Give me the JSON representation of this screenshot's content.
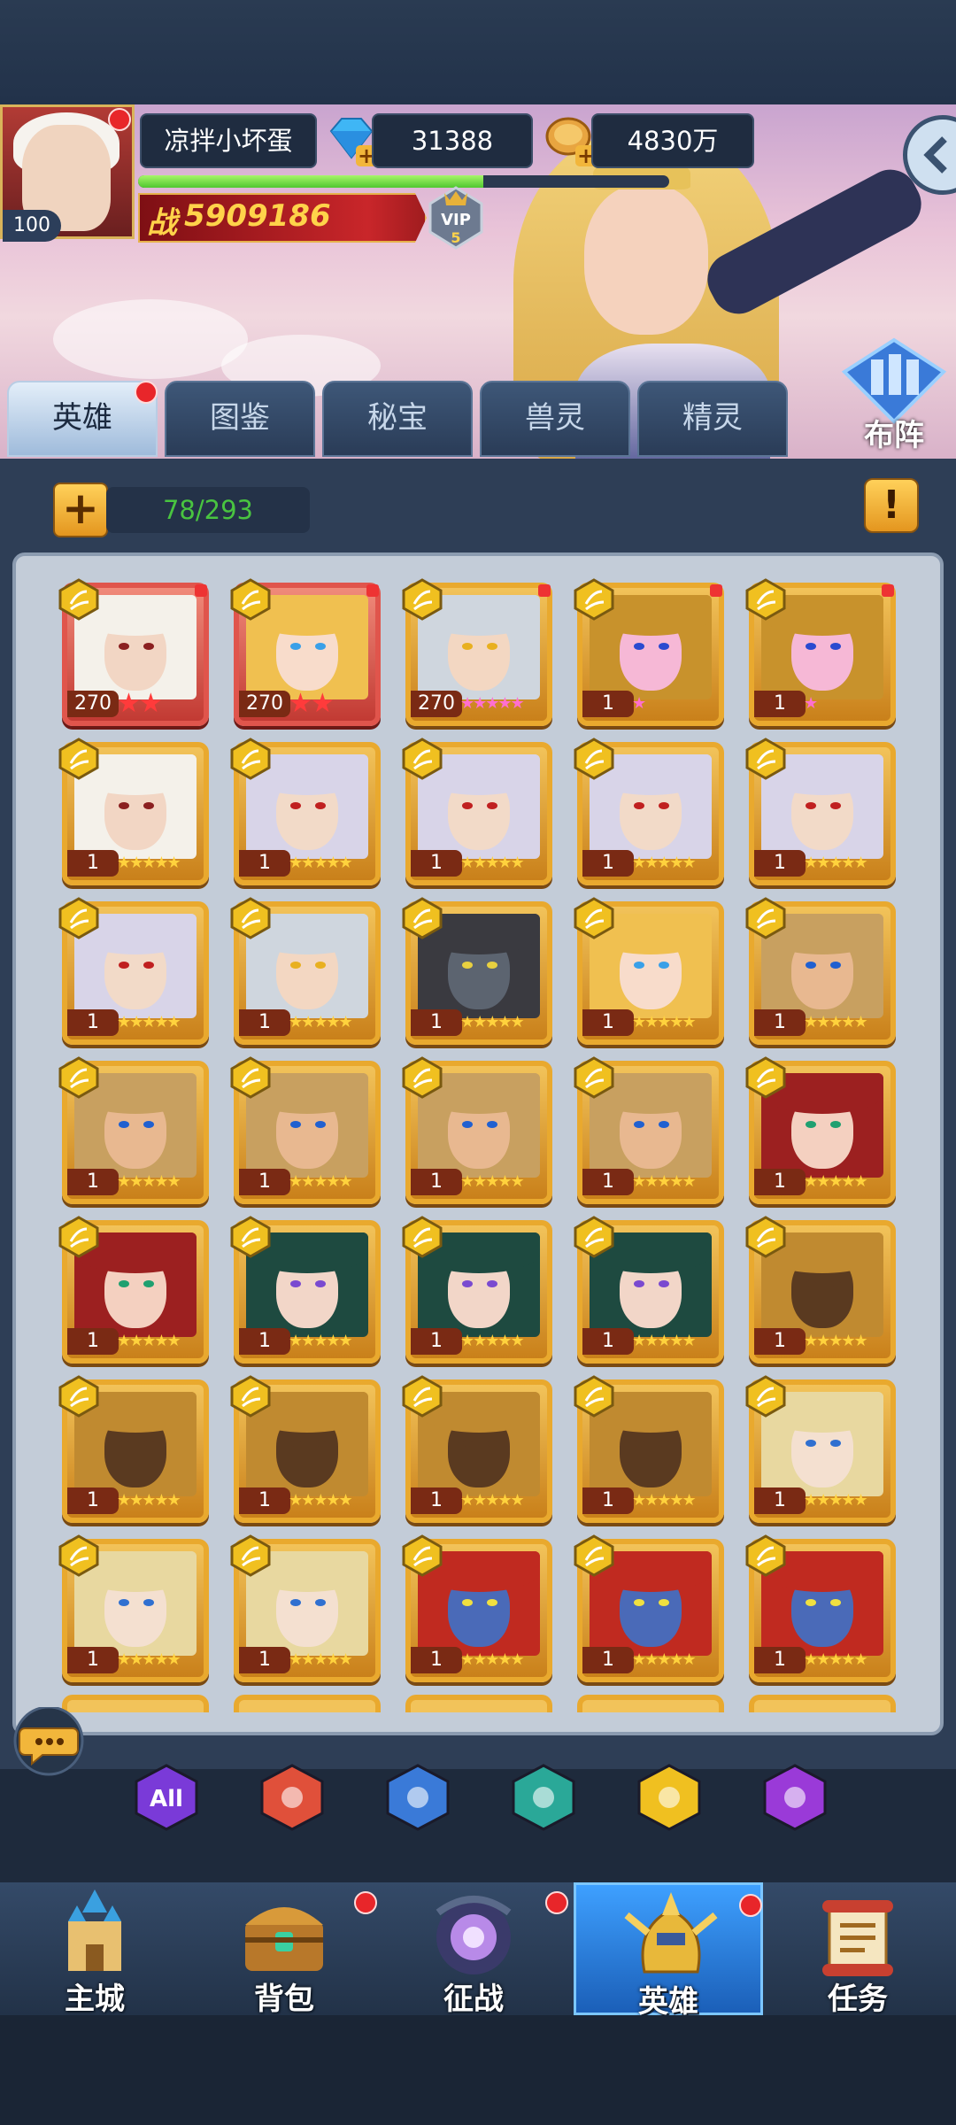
{
  "player": {
    "name": "凉拌小坏蛋",
    "level": "100",
    "power_label": "战",
    "power": "5909186",
    "vip": "VIP",
    "vip_level": "5",
    "exp_progress": 0.65
  },
  "resources": {
    "diamonds": "31388",
    "gold": "4830万"
  },
  "formation": {
    "label": "布阵"
  },
  "tabs": [
    {
      "label": "英雄",
      "active": true
    },
    {
      "label": "图鉴"
    },
    {
      "label": "秘宝"
    },
    {
      "label": "兽灵"
    },
    {
      "label": "精灵"
    }
  ],
  "hero_count": "78/293",
  "heroes": [
    {
      "level": "270",
      "stars": "★★",
      "frame": "red",
      "star_color": "red",
      "hair": "#f4f1ea",
      "face": "#f2d6c4",
      "eye": "#8b2020"
    },
    {
      "level": "270",
      "stars": "★★",
      "frame": "red",
      "star_color": "red",
      "hair": "#f0c050",
      "face": "#f8dccb",
      "eye": "#3aa0e8"
    },
    {
      "level": "270",
      "stars": "★★★★★",
      "frame": "gold",
      "star_color": "pink",
      "hair": "#cfd6de",
      "face": "#f3d7c2",
      "eye": "#e8b020"
    },
    {
      "level": "1",
      "stars": "★",
      "frame": "gold",
      "star_color": "pink",
      "hair": "#c8922c",
      "face": "#f6b8d6",
      "eye": "#2a4ad0"
    },
    {
      "level": "1",
      "stars": "★",
      "frame": "gold",
      "star_color": "pink",
      "hair": "#c8922c",
      "face": "#f6b8d6",
      "eye": "#2a4ad0"
    },
    {
      "level": "1",
      "stars": "★★★★★",
      "frame": "gold",
      "star_color": "gold",
      "hair": "#f4f1ea",
      "face": "#f2d6c4",
      "eye": "#8b2020"
    },
    {
      "level": "1",
      "stars": "★★★★★",
      "frame": "gold",
      "star_color": "gold",
      "hair": "#d8d4e8",
      "face": "#f2dac8",
      "eye": "#c02020"
    },
    {
      "level": "1",
      "stars": "★★★★★",
      "frame": "gold",
      "star_color": "gold",
      "hair": "#d8d4e8",
      "face": "#f2dac8",
      "eye": "#c02020"
    },
    {
      "level": "1",
      "stars": "★★★★★",
      "frame": "gold",
      "star_color": "gold",
      "hair": "#d8d4e8",
      "face": "#f2dac8",
      "eye": "#c02020"
    },
    {
      "level": "1",
      "stars": "★★★★★",
      "frame": "gold",
      "star_color": "gold",
      "hair": "#d8d4e8",
      "face": "#f2dac8",
      "eye": "#c02020"
    },
    {
      "level": "1",
      "stars": "★★★★★",
      "frame": "gold",
      "star_color": "gold",
      "hair": "#d8d4e8",
      "face": "#f2dac8",
      "eye": "#c02020"
    },
    {
      "level": "1",
      "stars": "★★★★★",
      "frame": "gold",
      "star_color": "gold",
      "hair": "#cfd6de",
      "face": "#f3d7c2",
      "eye": "#e8b020"
    },
    {
      "level": "1",
      "stars": "★★★★★",
      "frame": "gold",
      "star_color": "gold",
      "hair": "#3a3a40",
      "face": "#5c6470",
      "eye": "#e8d040"
    },
    {
      "level": "1",
      "stars": "★★★★★",
      "frame": "gold",
      "star_color": "gold",
      "hair": "#f0c050",
      "face": "#f8dccb",
      "eye": "#3aa0e8"
    },
    {
      "level": "1",
      "stars": "★★★★★",
      "frame": "gold",
      "star_color": "gold",
      "hair": "#c8a060",
      "face": "#e8b890",
      "eye": "#2060d0"
    },
    {
      "level": "1",
      "stars": "★★★★★",
      "frame": "gold",
      "star_color": "gold",
      "hair": "#c8a060",
      "face": "#e8b890",
      "eye": "#2060d0"
    },
    {
      "level": "1",
      "stars": "★★★★★",
      "frame": "gold",
      "star_color": "gold",
      "hair": "#c8a060",
      "face": "#e8b890",
      "eye": "#2060d0"
    },
    {
      "level": "1",
      "stars": "★★★★★",
      "frame": "gold",
      "star_color": "gold",
      "hair": "#c8a060",
      "face": "#e8b890",
      "eye": "#2060d0"
    },
    {
      "level": "1",
      "stars": "★★★★★",
      "frame": "gold",
      "star_color": "gold",
      "hair": "#c8a060",
      "face": "#e8b890",
      "eye": "#2060d0"
    },
    {
      "level": "1",
      "stars": "★★★★★",
      "frame": "gold",
      "star_color": "gold",
      "hair": "#9c2020",
      "face": "#f4d0c0",
      "eye": "#20a070"
    },
    {
      "level": "1",
      "stars": "★★★★★",
      "frame": "gold",
      "star_color": "gold",
      "hair": "#9c2020",
      "face": "#f4d0c0",
      "eye": "#20a070"
    },
    {
      "level": "1",
      "stars": "★★★★★",
      "frame": "gold",
      "star_color": "gold",
      "hair": "#1e4a40",
      "face": "#f2d6c8",
      "eye": "#7a4ad0"
    },
    {
      "level": "1",
      "stars": "★★★★★",
      "frame": "gold",
      "star_color": "gold",
      "hair": "#1e4a40",
      "face": "#f2d6c8",
      "eye": "#7a4ad0"
    },
    {
      "level": "1",
      "stars": "★★★★★",
      "frame": "gold",
      "star_color": "gold",
      "hair": "#1e4a40",
      "face": "#f2d6c8",
      "eye": "#7a4ad0"
    },
    {
      "level": "1",
      "stars": "★★★★★",
      "frame": "gold",
      "star_color": "gold",
      "hair": "#c08a30",
      "face": "#5a3a20",
      "eye": "#5a3a20"
    },
    {
      "level": "1",
      "stars": "★★★★★",
      "frame": "gold",
      "star_color": "gold",
      "hair": "#c08a30",
      "face": "#5a3a20",
      "eye": "#5a3a20"
    },
    {
      "level": "1",
      "stars": "★★★★★",
      "frame": "gold",
      "star_color": "gold",
      "hair": "#c08a30",
      "face": "#5a3a20",
      "eye": "#5a3a20"
    },
    {
      "level": "1",
      "stars": "★★★★★",
      "frame": "gold",
      "star_color": "gold",
      "hair": "#c08a30",
      "face": "#5a3a20",
      "eye": "#5a3a20"
    },
    {
      "level": "1",
      "stars": "★★★★★",
      "frame": "gold",
      "star_color": "gold",
      "hair": "#c08a30",
      "face": "#5a3a20",
      "eye": "#5a3a20"
    },
    {
      "level": "1",
      "stars": "★★★★★",
      "frame": "gold",
      "star_color": "gold",
      "hair": "#e8d8a0",
      "face": "#f4e0d0",
      "eye": "#3070d0"
    },
    {
      "level": "1",
      "stars": "★★★★★",
      "frame": "gold",
      "star_color": "gold",
      "hair": "#e8d8a0",
      "face": "#f4e0d0",
      "eye": "#3070d0"
    },
    {
      "level": "1",
      "stars": "★★★★★",
      "frame": "gold",
      "star_color": "gold",
      "hair": "#e8d8a0",
      "face": "#f4e0d0",
      "eye": "#3070d0"
    },
    {
      "level": "1",
      "stars": "★★★★★",
      "frame": "gold",
      "star_color": "gold",
      "hair": "#c02a20",
      "face": "#4a6ab8",
      "eye": "#f0e040"
    },
    {
      "level": "1",
      "stars": "★★★★★",
      "frame": "gold",
      "star_color": "gold",
      "hair": "#c02a20",
      "face": "#4a6ab8",
      "eye": "#f0e040"
    },
    {
      "level": "1",
      "stars": "★★★★★",
      "frame": "gold",
      "star_color": "gold",
      "hair": "#c02a20",
      "face": "#4a6ab8",
      "eye": "#f0e040"
    }
  ],
  "filters": [
    {
      "name": "all",
      "label": "All",
      "color": "#7a3ad8"
    },
    {
      "name": "fire",
      "color": "#e0503a"
    },
    {
      "name": "water",
      "color": "#3a7ad8"
    },
    {
      "name": "dark",
      "color": "#2aa898"
    },
    {
      "name": "light",
      "color": "#f0c020"
    },
    {
      "name": "demon",
      "color": "#9a3ad8"
    }
  ],
  "nav": [
    {
      "label": "主城",
      "badge": false
    },
    {
      "label": "背包",
      "badge": true
    },
    {
      "label": "征战",
      "badge": true
    },
    {
      "label": "英雄",
      "badge": true,
      "active": true
    },
    {
      "label": "任务",
      "badge": false
    }
  ]
}
